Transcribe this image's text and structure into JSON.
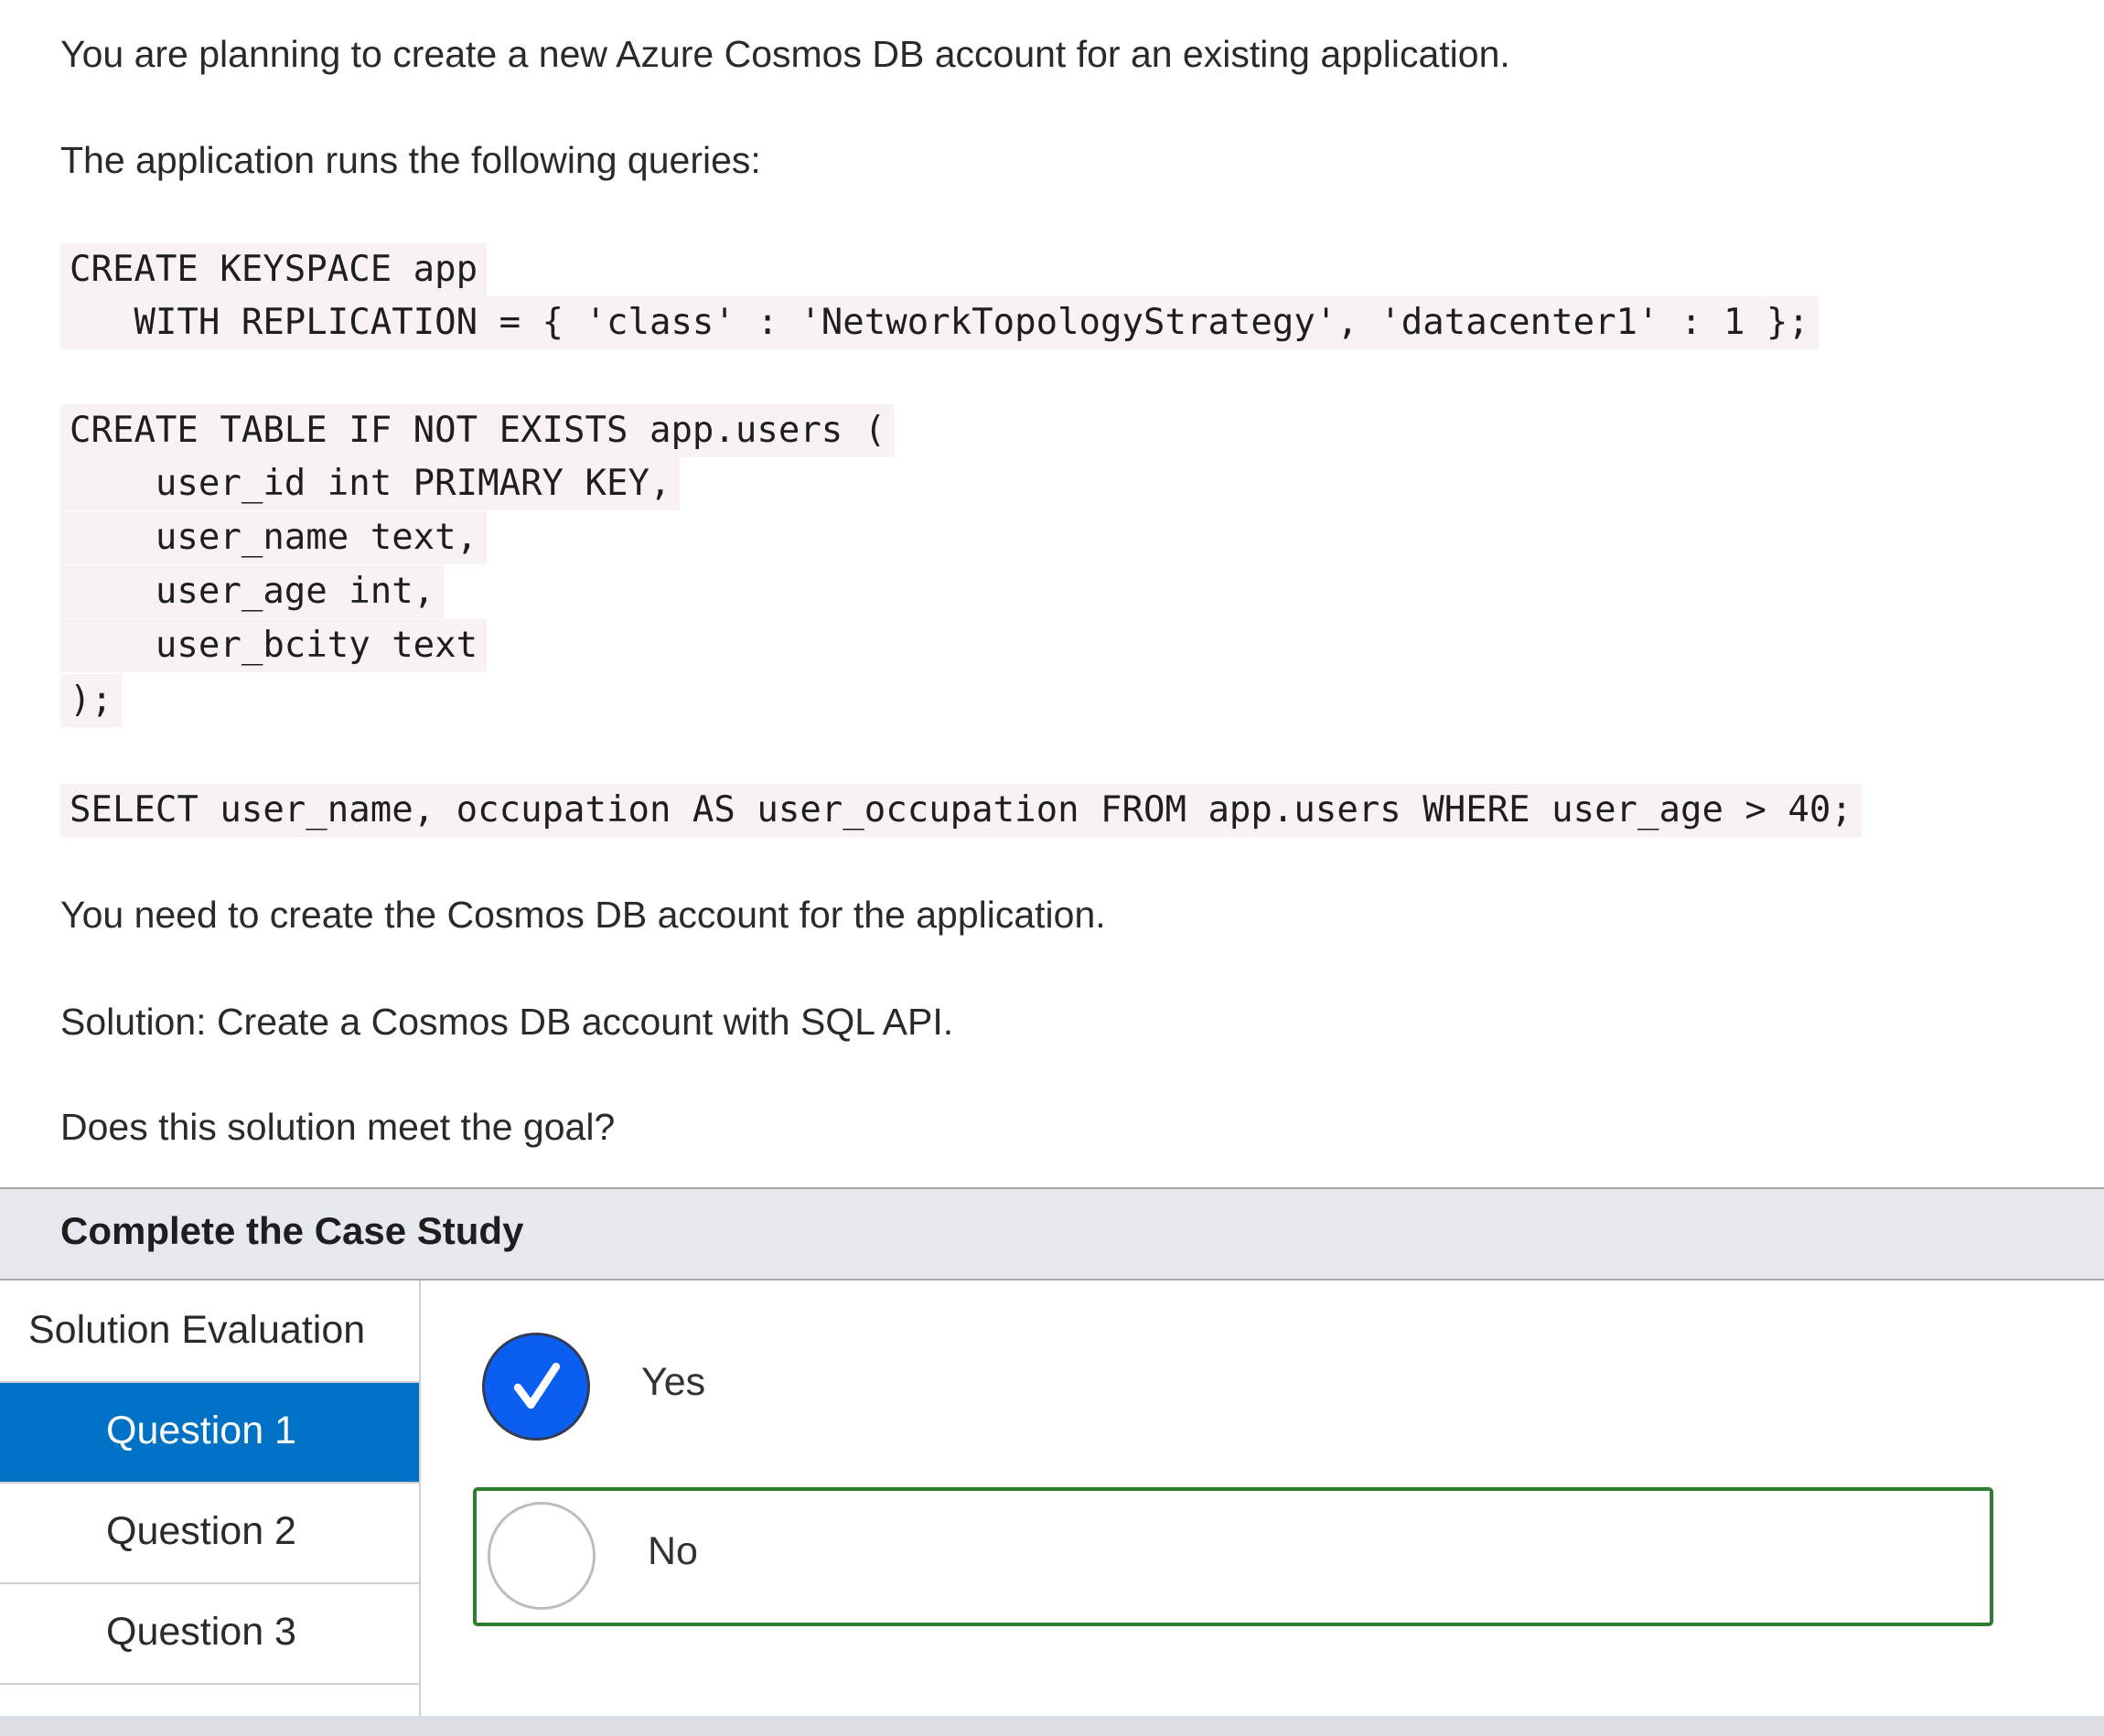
{
  "question": {
    "intro": "You are planning to create a new Azure Cosmos DB account for an existing application.",
    "queries_intro": "The application runs the following queries:",
    "code": {
      "keyspace_line1": "CREATE KEYSPACE app",
      "keyspace_line2": "   WITH REPLICATION = { 'class' : 'NetworkTopologyStrategy', 'datacenter1' : 1 };",
      "table_line1": "CREATE TABLE IF NOT EXISTS app.users (",
      "table_line2": "    user_id int PRIMARY KEY,",
      "table_line3": "    user_name text,",
      "table_line4": "    user_age int,",
      "table_line5": "    user_bcity text",
      "table_line6": ");",
      "select_line": "SELECT user_name, occupation AS user_occupation FROM app.users WHERE user_age > 40;"
    },
    "need": "You need to create the Cosmos DB account for the application.",
    "solution": "Solution: Create a Cosmos DB account with SQL API.",
    "prompt": "Does this solution meet the goal?"
  },
  "case_study": {
    "title": "Complete the Case Study"
  },
  "nav": {
    "header": "Solution Evaluation",
    "items": [
      {
        "label": "Question 1",
        "active": true
      },
      {
        "label": "Question 2",
        "active": false
      },
      {
        "label": "Question 3",
        "active": false
      }
    ]
  },
  "answers": {
    "options": [
      {
        "label": "Yes",
        "checked": true
      },
      {
        "label": "No",
        "checked": false,
        "highlighted": true
      }
    ]
  },
  "colors": {
    "active_nav": "#0072c6",
    "checked_radio": "#0a5ff0",
    "highlight_border": "#2e7d32",
    "header_bg": "#e5e9ee",
    "code_bg": "#f8f2f2"
  }
}
